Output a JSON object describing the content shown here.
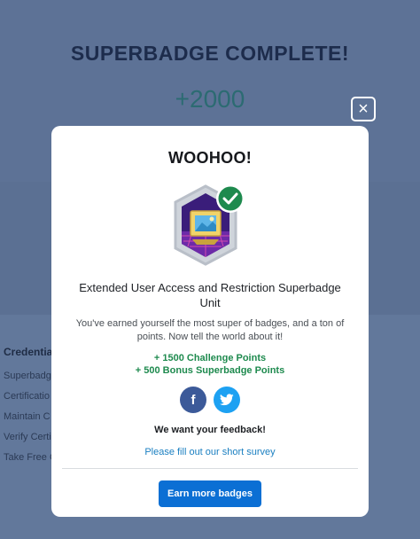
{
  "background": {
    "title": "SUPERBADGE COMPLETE!",
    "points": "+2000",
    "credentials_heading": "Credentia",
    "credentials_items": [
      "Superbadg",
      "Certificatio",
      "Maintain C",
      "Verify Certi",
      "Take Free C"
    ]
  },
  "close_glyph": "×",
  "modal": {
    "title": "WOOHOO!",
    "badge_name": "Extended User Access and Restriction Superbadge Unit",
    "description": "You've earned yourself the most super of badges, and a ton of points. Now tell the world about it!",
    "points_lines": [
      "+ 1500 Challenge Points",
      "+ 500 Bonus Superbadge Points"
    ],
    "facebook_glyph": "f",
    "feedback_title": "We want your feedback!",
    "survey_link": "Please fill out our short survey",
    "earn_button": "Earn more badges"
  },
  "colors": {
    "overlay": "#5d7296",
    "accent_blue": "#0b6fd4",
    "points_green": "#1e8a4e",
    "facebook": "#3c5a99",
    "twitter": "#1da1f2",
    "badge_check": "#1e8a4e"
  },
  "icons": [
    "close-icon",
    "badge-icon",
    "checkmark-icon",
    "facebook-icon",
    "twitter-icon"
  ]
}
